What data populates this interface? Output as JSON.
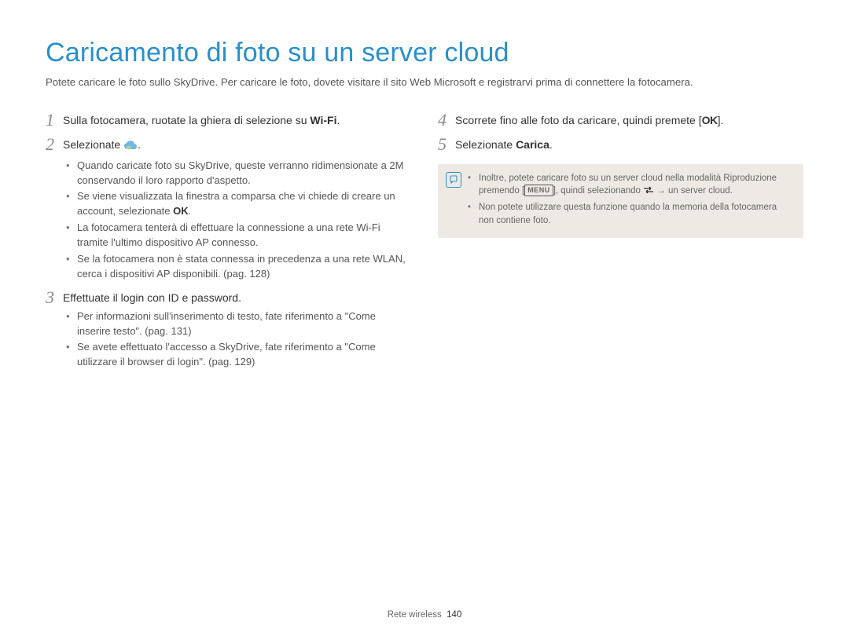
{
  "title": "Caricamento di foto su un server cloud",
  "intro": "Potete caricare le foto sullo SkyDrive. Per caricare le foto, dovete visitare il sito Web Microsoft e registrarvi prima di connettere la fotocamera.",
  "left": {
    "step1": {
      "num": "1",
      "pre": "Sulla fotocamera, ruotate la ghiera di selezione su ",
      "wifi": "Wi-Fi",
      "post": "."
    },
    "step2": {
      "num": "2",
      "pre": "Selezionate ",
      "post": ".",
      "bullets": [
        "Quando caricate foto su SkyDrive, queste verranno ridimensionate a 2M conservando il loro rapporto d'aspetto.",
        "Se viene visualizzata la finestra a comparsa che vi chiede di creare un account, selezionate ",
        "La fotocamera tenterà di effettuare la connessione a una rete Wi-Fi tramite l'ultimo dispositivo AP connesso.",
        "Se la fotocamera non è stata connessa in precedenza a una rete WLAN, cerca i dispositivi AP disponibili. (pag. 128)"
      ],
      "ok_label": "OK"
    },
    "step3": {
      "num": "3",
      "text": "Effettuate il login con ID e password.",
      "bullets": [
        "Per informazioni sull'inserimento di testo, fate riferimento a \"Come inserire testo\". (pag. 131)",
        "Se avete effettuato l'accesso a SkyDrive, fate riferimento a \"Come utilizzare il browser di login\". (pag. 129)"
      ]
    }
  },
  "right": {
    "step4": {
      "num": "4",
      "pre": "Scorrete fino alle foto da caricare, quindi premete [",
      "ok": "OK",
      "post": "]."
    },
    "step5": {
      "num": "5",
      "pre": "Selezionate ",
      "bold": "Carica",
      "post": "."
    },
    "note": {
      "bullets": [
        {
          "pre": "Inoltre, potete caricare foto su un server cloud nella modalità Riproduzione premendo [",
          "menu": "MENU",
          "mid": "], quindi selezionando ",
          "arrow": " → un server cloud."
        },
        {
          "text": "Non potete utilizzare questa funzione quando la memoria della fotocamera non contiene foto."
        }
      ]
    }
  },
  "footer": {
    "section": "Rete wireless",
    "page": "140"
  }
}
